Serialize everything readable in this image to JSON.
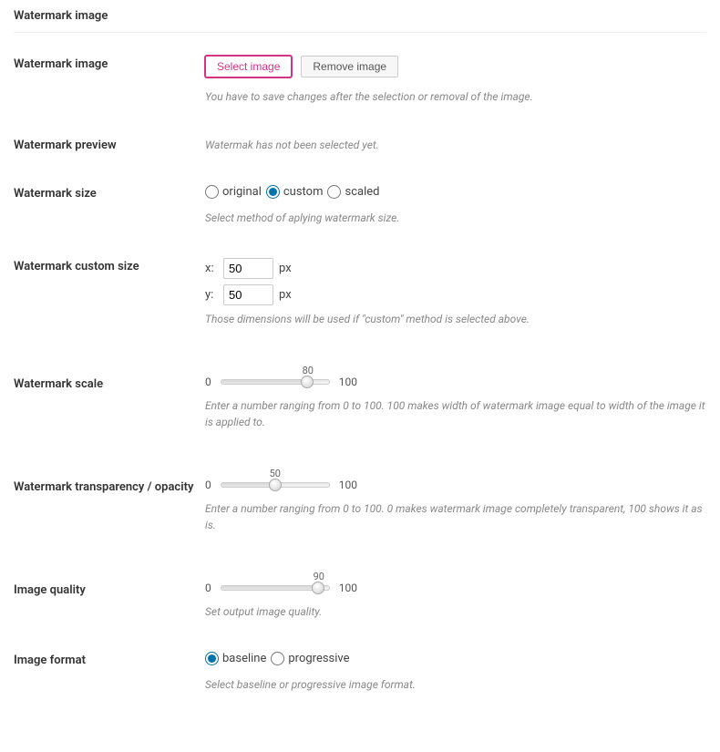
{
  "pageTitle": "Watermark image",
  "rows": {
    "image": {
      "label": "Watermark image",
      "selectBtn": "Select image",
      "removeBtn": "Remove image",
      "help": "You have to save changes after the selection or removal of the image."
    },
    "preview": {
      "label": "Watermark preview",
      "text": "Watermak has not been selected yet."
    },
    "size": {
      "label": "Watermark size",
      "options": {
        "original": "original",
        "custom": "custom",
        "scaled": "scaled"
      },
      "selected": "custom",
      "help": "Select method of aplying watermark size."
    },
    "customSize": {
      "label": "Watermark custom size",
      "xLabel": "x:",
      "yLabel": "y:",
      "xValue": "50",
      "yValue": "50",
      "unit": "px",
      "help": "Those dimensions will be used if \"custom\" method is selected above."
    },
    "scale": {
      "label": "Watermark scale",
      "min": "0",
      "max": "100",
      "value": "80",
      "help": "Enter a number ranging from 0 to 100. 100 makes width of watermark image equal to width of the image it is applied to."
    },
    "transparency": {
      "label": "Watermark transparency / opacity",
      "min": "0",
      "max": "100",
      "value": "50",
      "help": "Enter a number ranging from 0 to 100. 0 makes watermark image completely transparent, 100 shows it as is."
    },
    "quality": {
      "label": "Image quality",
      "min": "0",
      "max": "100",
      "value": "90",
      "help": "Set output image quality."
    },
    "format": {
      "label": "Image format",
      "options": {
        "baseline": "baseline",
        "progressive": "progressive"
      },
      "selected": "baseline",
      "help": "Select baseline or progressive image format."
    }
  }
}
